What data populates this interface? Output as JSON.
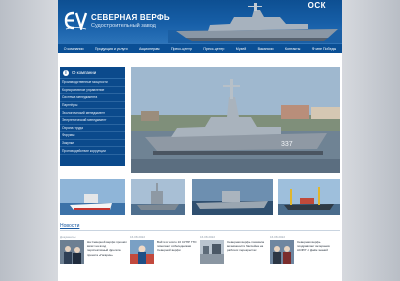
{
  "brand": {
    "title": "СЕВЕРНАЯ ВЕРФЬ",
    "subtitle": "Судостроительный завод",
    "partner_logo": "ОСК"
  },
  "nav": {
    "items": [
      "О компании",
      "Продукция и услуги",
      "Акционерам",
      "Пресс-центр",
      "Пресс-центр",
      "Музей",
      "Вакансии",
      "Контакты",
      "Ф мне Победы"
    ]
  },
  "sidebar": {
    "title": "О компании",
    "items": [
      "Производственные мощности",
      "Корпоративное управление",
      "Система менеджмента",
      "Партнёры",
      "Экологический менеджмент",
      "Энергетический менеджмент",
      "Охрана труда",
      "Форумы",
      "Закупки",
      "Противодействие коррупции"
    ]
  },
  "hero": {
    "hull_number": "337"
  },
  "news": {
    "title": "Новости",
    "items": [
      {
        "date": "Документы",
        "text": "На Северной верфи прошёл визит на вход перспективный фрегата проекта «Гагарин»"
      },
      {
        "date": "16.08.2022",
        "text": "Войти в число 10 СУПР ГТО помогают собеседникам Северной верфи"
      },
      {
        "date": "16.08.2022",
        "text": "Северная верфь показала возможности бассейна на рабочих перекрестах"
      },
      {
        "date": "16.08.2022",
        "text": "Северная верфь поздравляет ветеранов АСФУГ с Днём знаний"
      }
    ]
  },
  "colors": {
    "brand_blue": "#0b4a8c",
    "nav_blue": "#0a4f95",
    "header_blue": "#175fa8",
    "link_blue": "#1a5aa3"
  },
  "icons": {
    "logo": "ship-logo-icon",
    "sidebar_head": "info-icon"
  }
}
